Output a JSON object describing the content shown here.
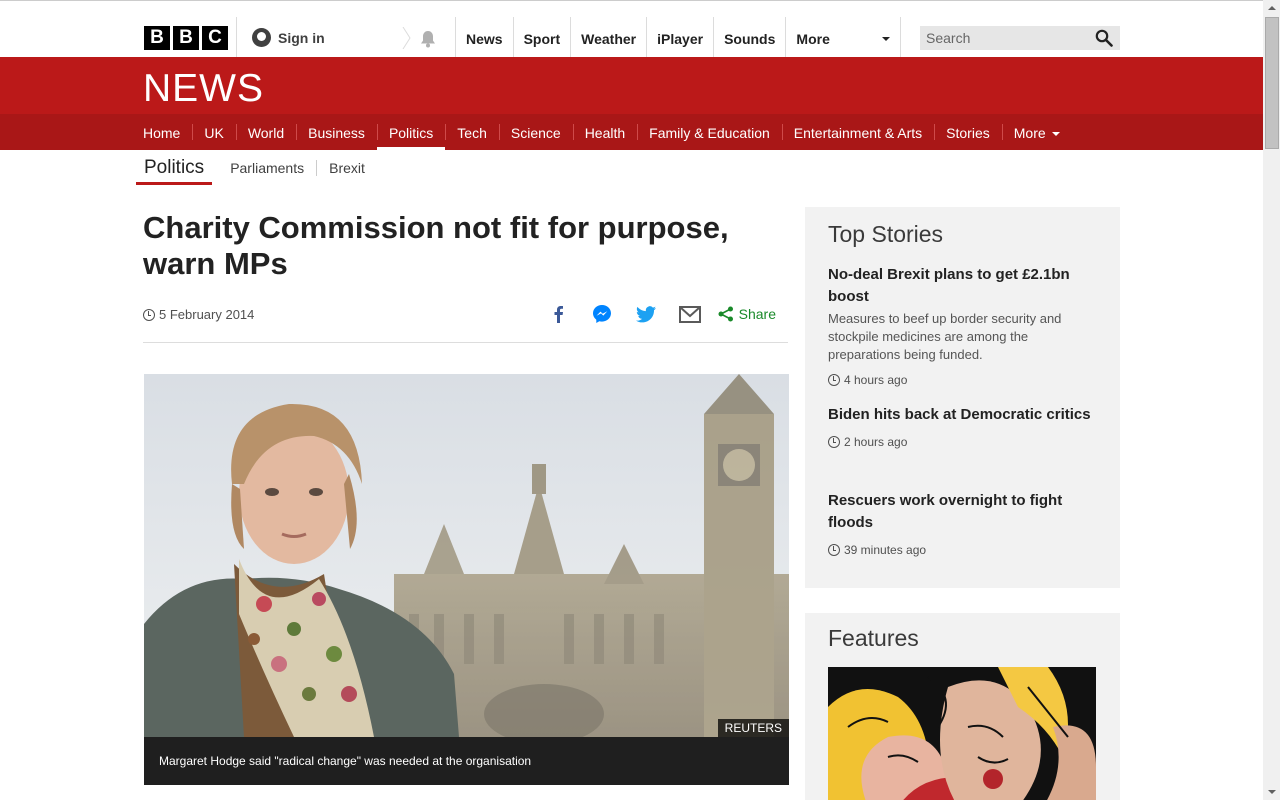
{
  "bbc_logo": [
    "B",
    "B",
    "C"
  ],
  "account": {
    "signin_label": "Sign in"
  },
  "top_nav": {
    "items": [
      "News",
      "Sport",
      "Weather",
      "iPlayer",
      "Sounds"
    ],
    "more_label": "More"
  },
  "search": {
    "placeholder": "Search"
  },
  "news_header": {
    "wordmark": "NEWS"
  },
  "news_nav": {
    "items": [
      "Home",
      "UK",
      "World",
      "Business",
      "Politics",
      "Tech",
      "Science",
      "Health",
      "Family & Education",
      "Entertainment & Arts",
      "Stories"
    ],
    "active": "Politics",
    "more_label": "More"
  },
  "section_nav": {
    "current": "Politics",
    "links": [
      "Parliaments",
      "Brexit"
    ]
  },
  "article": {
    "headline": "Charity Commission not fit for purpose, warn MPs",
    "date": "5 February 2014",
    "share_label": "Share",
    "image_credit": "REUTERS",
    "image_caption": "Margaret Hodge said \"radical change\" was needed at the organisation"
  },
  "top_stories": {
    "title": "Top Stories",
    "stories": [
      {
        "title": "No-deal Brexit plans to get £2.1bn boost",
        "summary": "Measures to beef up border security and stockpile medicines are among the preparations being funded.",
        "time": "4 hours ago"
      },
      {
        "title": "Biden hits back at Democratic critics",
        "time": "2 hours ago"
      },
      {
        "title": "Rescuers work overnight to fight floods",
        "time": "39 minutes ago"
      }
    ]
  },
  "features": {
    "title": "Features"
  },
  "colors": {
    "bbc_red": "#bb1919",
    "nav_red": "#a91717",
    "share_green": "#1a8a2a",
    "twitter_blue": "#1da1f2",
    "facebook_blue": "#3b5998"
  }
}
